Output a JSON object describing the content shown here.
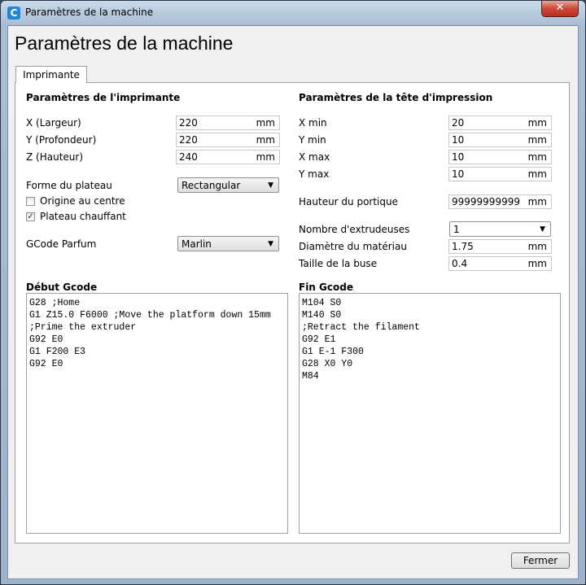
{
  "window": {
    "title": "Paramètres de la machine",
    "close_glyph": "✕",
    "app_icon": "cura-icon",
    "app_icon_letter": "C"
  },
  "page": {
    "heading": "Paramètres de la machine"
  },
  "tabs": [
    {
      "label": "Imprimante",
      "selected": true
    }
  ],
  "printer": {
    "section_title": "Paramètres de l'imprimante",
    "dims": [
      {
        "label": "X (Largeur)",
        "value": "220",
        "unit": "mm"
      },
      {
        "label": "Y (Profondeur)",
        "value": "220",
        "unit": "mm"
      },
      {
        "label": "Z (Hauteur)",
        "value": "240",
        "unit": "mm"
      }
    ],
    "bed_shape": {
      "label": "Forme du plateau",
      "value": "Rectangular"
    },
    "origin_center": {
      "label": "Origine au centre",
      "checked": false
    },
    "heated_bed": {
      "label": "Plateau chauffant",
      "checked": true,
      "check_glyph": "✓"
    },
    "gcode_flavor": {
      "label": "GCode Parfum",
      "value": "Marlin"
    }
  },
  "head": {
    "section_title": "Paramètres de la tête d'impression",
    "dims": [
      {
        "label": "X min",
        "value": "20",
        "unit": "mm"
      },
      {
        "label": "Y min",
        "value": "10",
        "unit": "mm"
      },
      {
        "label": "X max",
        "value": "10",
        "unit": "mm"
      },
      {
        "label": "Y max",
        "value": "10",
        "unit": "mm"
      }
    ],
    "gantry": {
      "label": "Hauteur du portique",
      "value": "99999999999",
      "unit": "mm"
    },
    "extruders": {
      "label": "Nombre d'extrudeuses",
      "value": "1"
    },
    "material_diameter": {
      "label": "Diamètre du matériau",
      "value": "1.75",
      "unit": "mm"
    },
    "nozzle_size": {
      "label": "Taille de la buse",
      "value": "0.4",
      "unit": "mm"
    }
  },
  "start_gcode": {
    "label": "Début Gcode",
    "text": "G28 ;Home\nG1 Z15.0 F6000 ;Move the platform down 15mm\n;Prime the extruder\nG92 E0\nG1 F200 E3\nG92 E0"
  },
  "end_gcode": {
    "label": "Fin Gcode",
    "text": "M104 S0\nM140 S0\n;Retract the filament\nG92 E1\nG1 E-1 F300\nG28 X0 Y0\nM84"
  },
  "buttons": {
    "close_label": "Fermer"
  },
  "dropdown_arrow": "▼"
}
